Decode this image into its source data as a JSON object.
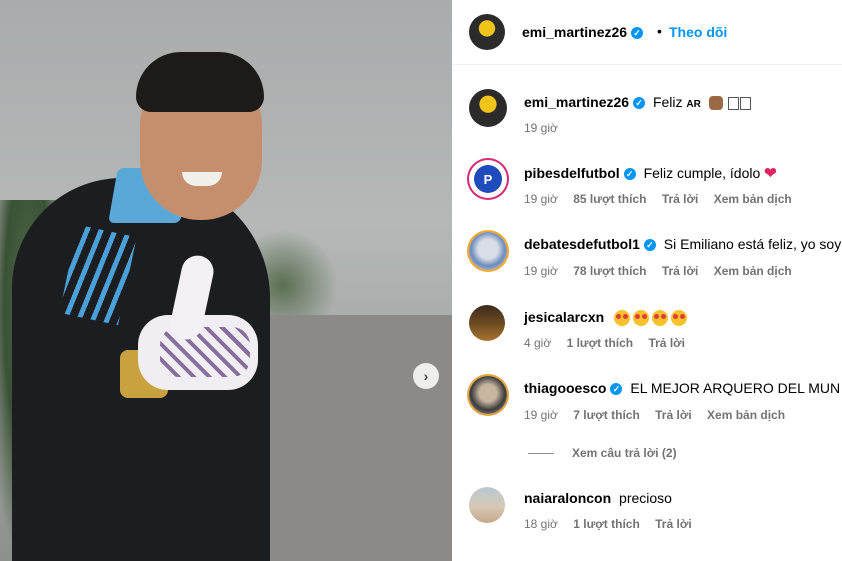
{
  "post": {
    "author": "emi_martinez26",
    "follow_label": "Theo dõi",
    "separator": "•"
  },
  "caption": {
    "username": "emi_martinez26",
    "text": "Feliz",
    "flag": "AR",
    "time": "19 giờ"
  },
  "comments": [
    {
      "username": "pibesdelfutbol",
      "verified": true,
      "text": "Feliz cumple, ídolo",
      "time": "19 giờ",
      "likes": "85 lượt thích",
      "reply": "Trả lời",
      "translate": "Xem bản dịch"
    },
    {
      "username": "debatesdefutbol1",
      "verified": true,
      "text": "Si Emiliano está feliz, yo soy f",
      "time": "19 giờ",
      "likes": "78 lượt thích",
      "reply": "Trả lời",
      "translate": "Xem bản dịch"
    },
    {
      "username": "jesicalarcxn",
      "verified": false,
      "text": "",
      "time": "4 giờ",
      "likes": "1 lượt thích",
      "reply": "Trả lời"
    },
    {
      "username": "thiagooesco",
      "verified": true,
      "text": "EL MEJOR ARQUERO DEL MUN",
      "time": "19 giờ",
      "likes": "7 lượt thích",
      "reply": "Trả lời",
      "translate": "Xem bản dịch",
      "view_replies": "Xem câu trả lời (2)"
    },
    {
      "username": "naiaraloncon",
      "verified": false,
      "text": "precioso",
      "time": "18 giờ",
      "likes": "1 lượt thích",
      "reply": "Trả lời"
    }
  ],
  "icons": {
    "next": "chevron-right-icon",
    "verified": "verified-badge-icon"
  },
  "colors": {
    "accent": "#0095f6",
    "meta_text": "#737373"
  }
}
